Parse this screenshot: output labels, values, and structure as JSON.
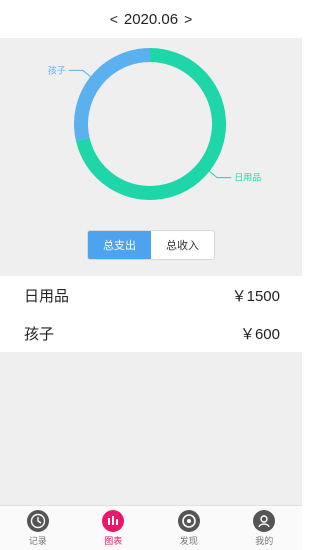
{
  "header": {
    "prev": "<",
    "period": "2020.06",
    "next": ">"
  },
  "chart_data": {
    "type": "pie",
    "categories": [
      "日用品",
      "孩子"
    ],
    "values": [
      1500,
      600
    ],
    "colors": [
      "#1fd6a9",
      "#5bb0ef"
    ]
  },
  "segment": {
    "expense_label": "总支出",
    "income_label": "总收入"
  },
  "rows": [
    {
      "name": "日用品",
      "amount": "￥1500"
    },
    {
      "name": "孩子",
      "amount": "￥600"
    }
  ],
  "tabs": [
    {
      "label": "记录",
      "icon": "clock-icon"
    },
    {
      "label": "图表",
      "icon": "bar-chart-icon"
    },
    {
      "label": "发现",
      "icon": "compass-icon"
    },
    {
      "label": "我的",
      "icon": "user-icon"
    }
  ],
  "colors": {
    "accent": "#4da3f0",
    "active_tab": "#e8196b",
    "tab_icon": "#555555"
  }
}
